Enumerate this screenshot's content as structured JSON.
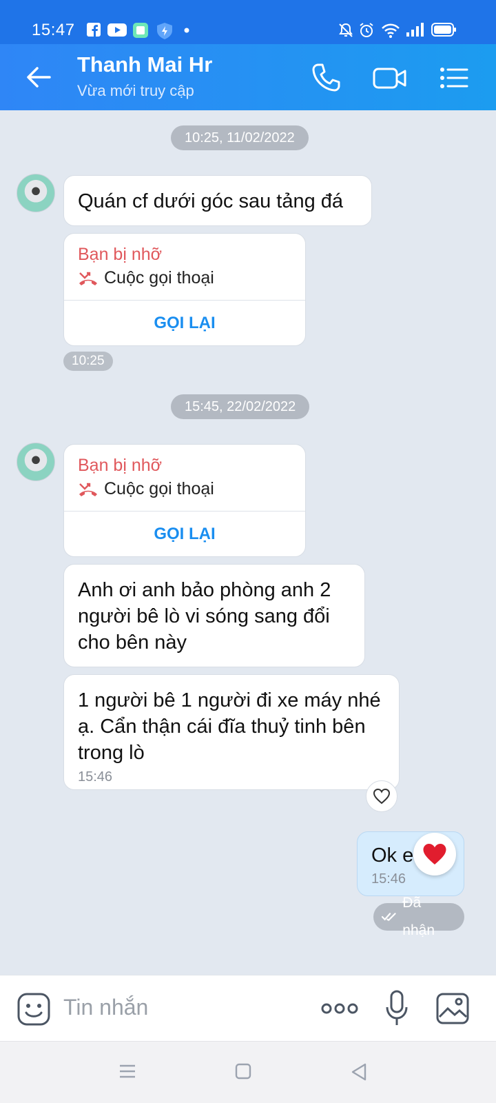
{
  "status_bar": {
    "time": "15:47"
  },
  "header": {
    "title": "Thanh Mai Hr",
    "subtitle": "Vừa mới truy cập"
  },
  "messages": {
    "date1": "10:25, 11/02/2022",
    "msg1": "Quán cf dưới góc sau tảng đá",
    "call1": {
      "missed_label": "Bạn bị nhỡ",
      "type_label": "Cuộc gọi thoại",
      "callback_label": "GỌI LẠI"
    },
    "time1": "10:25",
    "date2": "15:45, 22/02/2022",
    "call2": {
      "missed_label": "Bạn bị nhỡ",
      "type_label": "Cuộc gọi thoại",
      "callback_label": "GỌI LẠI"
    },
    "msg2": "Anh ơi anh bảo phòng anh 2 người bê lò vi sóng sang đổi cho bên này",
    "msg3": "1 người bê 1 người đi xe máy nhé ạ. Cẩn thận cái đĩa thuỷ tinh bên trong lò",
    "msg3_time": "15:46",
    "my_msg": "Ok em",
    "my_msg_time": "15:46",
    "delivery_status": "Đã nhận"
  },
  "input": {
    "placeholder": "Tin nhắn"
  },
  "colors": {
    "header": "#2f86f6",
    "missed": "#e0585c",
    "callback": "#1a8ef0",
    "my_bubble": "#d6ecfd"
  },
  "icons": [
    "back-arrow-icon",
    "phone-icon",
    "video-icon",
    "menu-icon",
    "missed-call-icon",
    "heart-outline-icon",
    "heart-icon",
    "double-check-icon",
    "emoji-icon",
    "more-icon",
    "mic-icon",
    "image-icon"
  ]
}
